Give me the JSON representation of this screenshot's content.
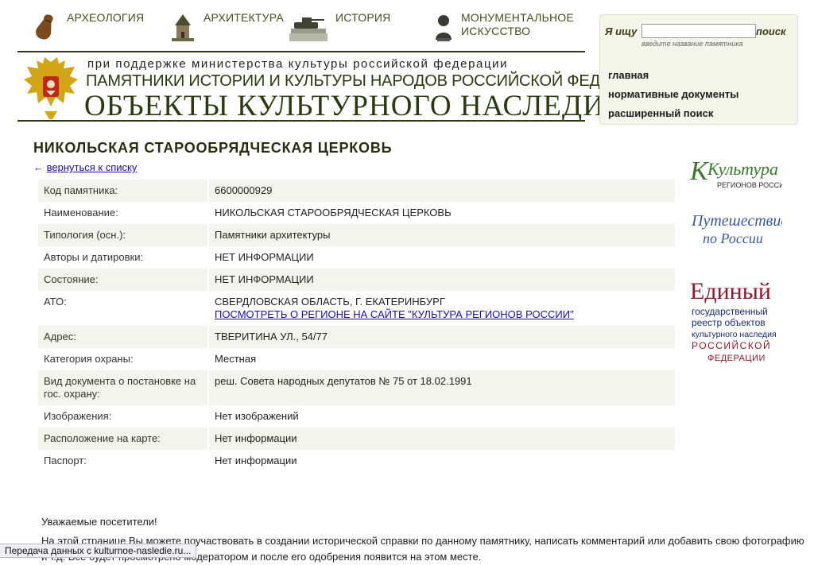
{
  "nav": {
    "items": [
      {
        "label": "АРХЕОЛОГИЯ",
        "icon": "amphora-icon"
      },
      {
        "label": "АРХИТЕКТУРА",
        "icon": "tower-icon"
      },
      {
        "label": "ИСТОРИЯ",
        "icon": "tank-monument-icon"
      },
      {
        "label_line1": "МОНУМЕНТАЛЬНОЕ",
        "label_line2": "ИСКУССТВО",
        "icon": "bust-icon"
      }
    ]
  },
  "header": {
    "support": "при поддержке министерства культуры российской федерации",
    "subtitle": "ПАМЯТНИКИ ИСТОРИИ И КУЛЬТУРЫ НАРОДОВ РОССИЙСКОЙ ФЕДЕРАЦИИ",
    "title": "ОБЪЕКТЫ КУЛЬТУРНОГО НАСЛЕДИЯ"
  },
  "search": {
    "label": "Я ищу",
    "value": "",
    "hint": "введите название памятника",
    "button": "поиск"
  },
  "links": {
    "home": "главная",
    "docs": "нормативные документы",
    "advanced": "расширенный поиск"
  },
  "page": {
    "title": "НИКОЛЬСКАЯ СТАРООБРЯДЧЕСКАЯ ЦЕРКОВЬ",
    "back_arrow": "←",
    "back_label": "вернуться к списку"
  },
  "rows": [
    {
      "key": "Код памятника:",
      "value": "6600000929"
    },
    {
      "key": "Наименование:",
      "value": "НИКОЛЬСКАЯ СТАРООБРЯДЧЕСКАЯ ЦЕРКОВЬ"
    },
    {
      "key": "Типология (осн.):",
      "value": "Памятники архитектуры"
    },
    {
      "key": "Авторы и датировки:",
      "value": "НЕТ ИНФОРМАЦИИ"
    },
    {
      "key": "Состояние:",
      "value": "НЕТ ИНФОРМАЦИИ"
    },
    {
      "key": "АТО:",
      "value": "СВЕРДЛОВСКАЯ ОБЛАСТЬ, Г. ЕКАТЕРИНБУРГ",
      "link": "ПОСМОТРЕТЬ О РЕГИОНЕ НА САЙТЕ \"КУЛЬТУРА РЕГИОНОВ РОССИИ\""
    },
    {
      "key": "Адрес:",
      "value": "ТВЕРИТИНА УЛ., 54/77"
    },
    {
      "key": "Категория охраны:",
      "value": "Местная"
    },
    {
      "key": "Вид документа о постановке на гос. охрану:",
      "value": "реш. Совета народных депутатов № 75 от 18.02.1991"
    },
    {
      "key": "Изображения:",
      "value": "Нет изображений"
    },
    {
      "key": "Расположение на карте:",
      "value": "Нет информации"
    },
    {
      "key": "Паспорт:",
      "value": "Нет информации"
    }
  ],
  "logos": {
    "kultura_main": "Культура",
    "kultura_sub": "РЕГИОНОВ РОССИИ",
    "put_line1": "Путешествие",
    "put_line2": "по России",
    "ed_line1": "Единый",
    "ed_line2": "государственный",
    "ed_line3": "реестр объектов",
    "ed_line4": "культурного наследия",
    "ed_line5": "РОССИЙСКОЙ",
    "ed_line6": "ФЕДЕРАЦИИ"
  },
  "footer": {
    "greeting": "Уважаемые посетители!",
    "text": "На этой странице Вы можете поучаствовать в создании исторической справки по данному памятнику, написать комментарий или добавить свою фотографию и т.д. Все будет просмотрено модератором и после его одобрения появится на этом месте."
  },
  "statusbar": {
    "text": "Передача данных с kulturnoe-nasledie.ru..."
  },
  "colors": {
    "olive_dark": "#2b3a10",
    "panel_bg": "#f5f5ea",
    "row_alt": "#f4f4ec",
    "link": "#1a0dab"
  }
}
